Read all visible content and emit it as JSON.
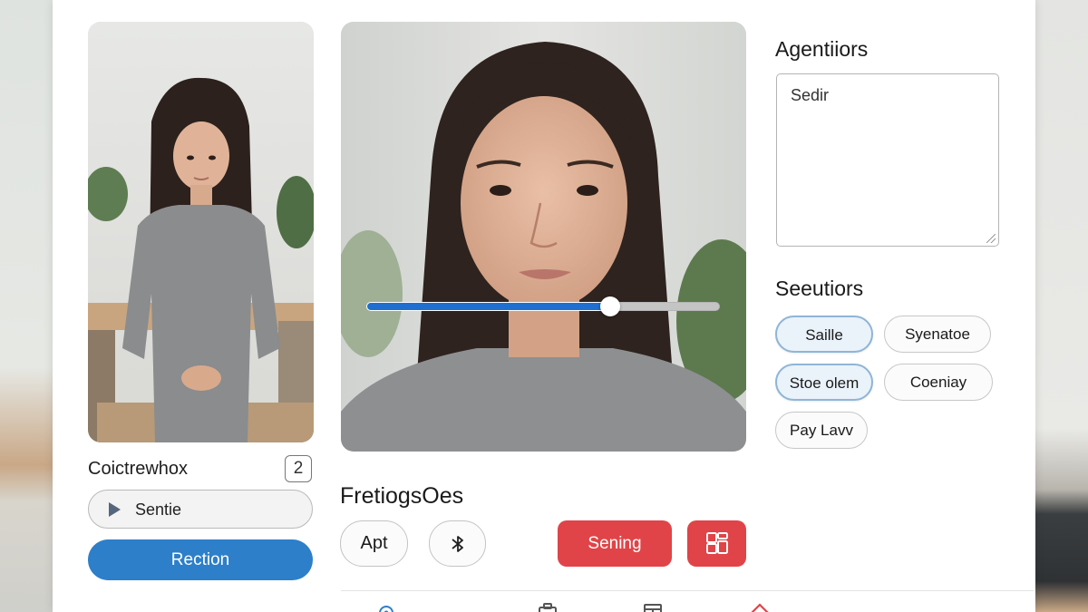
{
  "left_panel": {
    "heading": "Coictrewhox",
    "count": "2",
    "select_value": "Sentie",
    "primary_button": "Rection"
  },
  "slider": {
    "value_fraction": 0.69
  },
  "options": {
    "title": "FretiogsOes",
    "apt_button": "Apt",
    "bluetooth_icon": "bluetooth-icon",
    "sening_button": "Sening",
    "grid_icon": "layout-grid-icon"
  },
  "agent": {
    "title": "Agentiiors",
    "notes_value": "Sedir"
  },
  "sections": {
    "title": "Seeutiors",
    "chips": [
      {
        "label": "Saille",
        "selected": true
      },
      {
        "label": "Syenatoe",
        "selected": false
      },
      {
        "label": "Stoe olem",
        "selected": true
      },
      {
        "label": "Coeniay",
        "selected": false
      },
      {
        "label": "Pay Lavv",
        "selected": false
      }
    ]
  },
  "bottom_nav": {
    "icons": [
      "settings-icon",
      "briefcase-icon",
      "table-icon",
      "home-icon"
    ]
  },
  "colors": {
    "accent_blue": "#2d7fc9",
    "slider_blue": "#1e6fd0",
    "danger_red": "#e04448",
    "chip_selected_border": "#8fb5d6"
  }
}
